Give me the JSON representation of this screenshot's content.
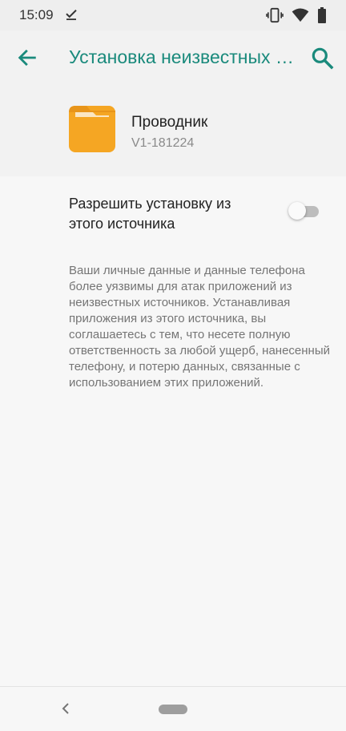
{
  "status_bar": {
    "time": "15:09",
    "icons": [
      "download-done-icon",
      "vibrate-icon",
      "wifi-icon",
      "battery-icon"
    ]
  },
  "toolbar": {
    "title": "Установка неизвестных приложений",
    "accent_color": "#1a8a7c",
    "icons": [
      "back-arrow-icon",
      "search-icon"
    ]
  },
  "app": {
    "name": "Проводник",
    "version": "V1-181224",
    "icon": "folder-icon",
    "icon_color": "#f5a623"
  },
  "setting": {
    "label": "Разрешить установку из этого источника",
    "enabled": false
  },
  "warning_text": "Ваши личные данные и данные телефона более уязвимы для атак приложений из неизвестных источников. Устанавливая приложения из этого источника, вы соглашаетесь с тем, что несете полную ответственность за любой ущерб, нанесенный телефону, и потерю данных, связанные с использованием этих приложений.",
  "nav_bar": {
    "icons": [
      "nav-back-icon",
      "home-pill-icon"
    ]
  }
}
